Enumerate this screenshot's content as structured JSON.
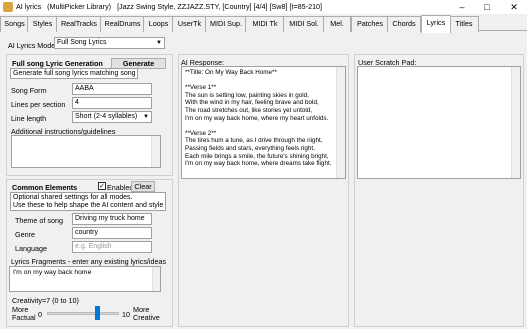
{
  "window": {
    "title_app": "AI lyrics",
    "title_context": "(MultiPicker Library)",
    "title_style": "[Jazz Swing Style, ZZJAZZ.STY,",
    "title_song": "[Country] [4/4] [Sw8] [t=85-210]"
  },
  "tabs": [
    "Songs",
    "Styles",
    "RealTracks",
    "RealDrums",
    "Loops",
    "UserTk",
    "MIDI Sup.",
    "MIDI Tk",
    "MIDI Sol.",
    "Mel.",
    "Patches",
    "Chords",
    "Lyrics",
    "Titles"
  ],
  "active_tab": "Lyrics",
  "mode": {
    "label": "AI Lyrics Mode",
    "value": "Full Song Lyrics"
  },
  "generation": {
    "header": "Full song Lyric Generation",
    "generate_label": "Generate",
    "description": "Generate full song lyrics matching song form.",
    "song_form_label": "Song Form",
    "song_form_value": "AABA",
    "lines_label": "Lines per section",
    "lines_value": "4",
    "line_length_label": "Line length",
    "line_length_value": "Short (2-4 syllables)",
    "additional_label": "Additional instructions/guidelines"
  },
  "common": {
    "header": "Common Elements",
    "enabled_label": "Enabled",
    "enabled": true,
    "clear_label": "Clear",
    "notes": [
      "Optional shared settings for all modes.",
      "Use these to help shape the AI content and style"
    ],
    "theme_label": "Theme of song",
    "theme_value": "Driving my truck home",
    "genre_label": "Genre",
    "genre_value": "country",
    "language_label": "Language",
    "language_placeholder": "e.g. English",
    "fragments_label": "Lyrics Fragments - enter any existing lyrics/ideas",
    "fragments_value": "I'm on my way back home",
    "creativity_label": "Creativity=7  (0 to 10)",
    "creativity_value": 7,
    "creativity_min": "0",
    "creativity_max": "10",
    "more_factual": [
      "More",
      "Factual"
    ],
    "more_creative": [
      "More",
      "Creative"
    ]
  },
  "ai_response": {
    "label": "AI Response:",
    "lines": [
      "**Title: On My Way Back Home**",
      "",
      "**Verse 1**",
      "The sun is setting low, painting skies in gold,",
      "With the wind in my hair, feeling brave and bold,",
      "The road stretches out, like stories yet untold,",
      "I'm on my way back home, where my heart unfolds.",
      "",
      "**Verse 2**",
      "The tires hum a tune, as I drive through the night,",
      "Passing fields and stars, everything feels right,",
      "Each mile brings a smile, the future's shining bright,",
      "I'm on my way back home, where dreams take flight."
    ]
  },
  "scratch_pad": {
    "label": "User Scratch Pad:"
  },
  "icons": {
    "app": "ai-lyrics-app-icon",
    "minimize": "minimize-icon",
    "maximize": "maximize-icon",
    "close": "close-icon"
  }
}
